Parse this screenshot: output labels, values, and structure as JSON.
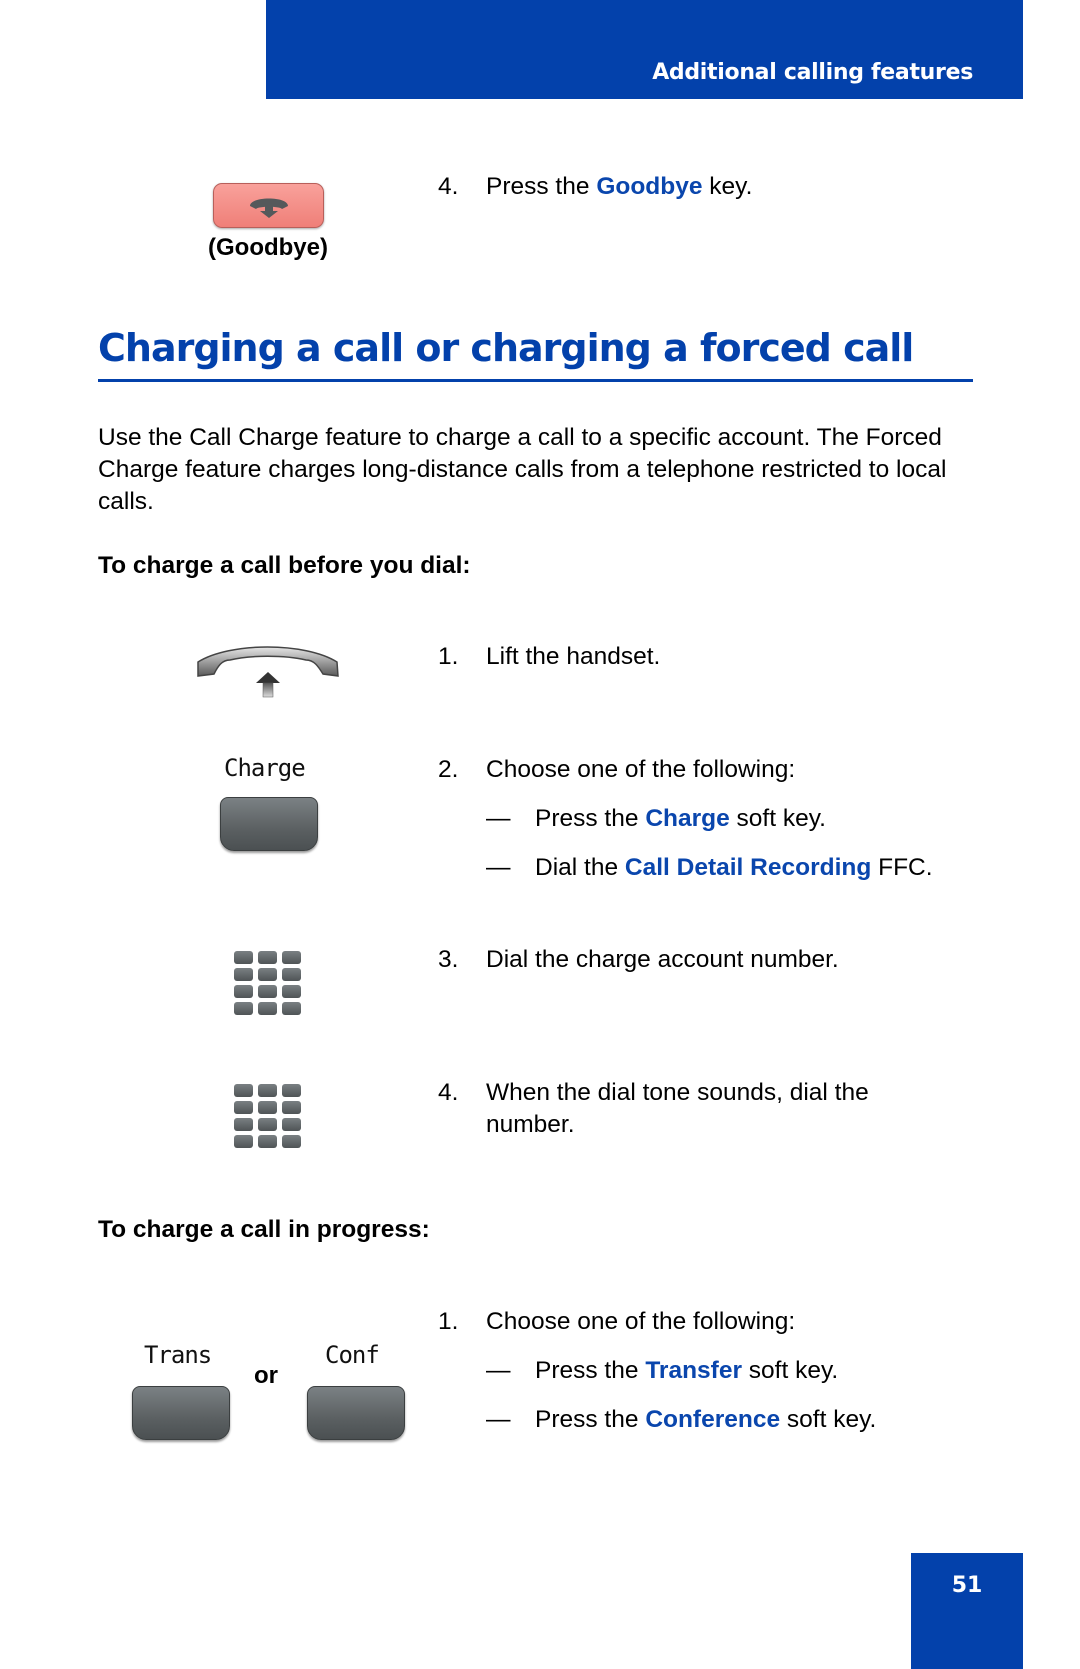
{
  "header": {
    "section_title": "Additional calling features"
  },
  "top_step": {
    "icon_label": "(Goodbye)",
    "number": "4.",
    "prefix": "Press the ",
    "key": "Goodbye",
    "suffix": " key."
  },
  "section": {
    "title": "Charging a call or charging a forced call",
    "intro": "Use the Call Charge feature to charge a call to a specific account. The Forced Charge feature charges long-distance calls from a telephone restricted to local calls."
  },
  "procedure_before_dial": {
    "heading": "To charge a call before you dial:",
    "steps": [
      {
        "number": "1.",
        "text": "Lift the handset."
      },
      {
        "number": "2.",
        "text": "Choose one of the following:",
        "lcd_label": "Charge",
        "options": [
          {
            "dash": "—",
            "prefix": "Press the ",
            "key": "Charge",
            "suffix": " soft key."
          },
          {
            "dash": "—",
            "prefix": "Dial the ",
            "key": "Call Detail Recording",
            "suffix": " FFC."
          }
        ]
      },
      {
        "number": "3.",
        "text": "Dial the charge account number."
      },
      {
        "number": "4.",
        "text_line1": "When the dial tone sounds, dial the",
        "text_line2": "number."
      }
    ]
  },
  "procedure_in_progress": {
    "heading": "To charge a call in progress:",
    "lcd_left": "Trans",
    "or_label": "or",
    "lcd_right": "Conf",
    "steps": [
      {
        "number": "1.",
        "text": "Choose one of the following:",
        "options": [
          {
            "dash": "—",
            "prefix": "Press the ",
            "key": "Transfer",
            "suffix": " soft key."
          },
          {
            "dash": "—",
            "prefix": "Press the ",
            "key": "Conference",
            "suffix": " soft key."
          }
        ]
      }
    ]
  },
  "footer": {
    "page_number": "51"
  },
  "colors": {
    "brand_blue": "#0341ab",
    "link_blue": "#0a46ad",
    "goodbye_key": "#f38b84"
  }
}
